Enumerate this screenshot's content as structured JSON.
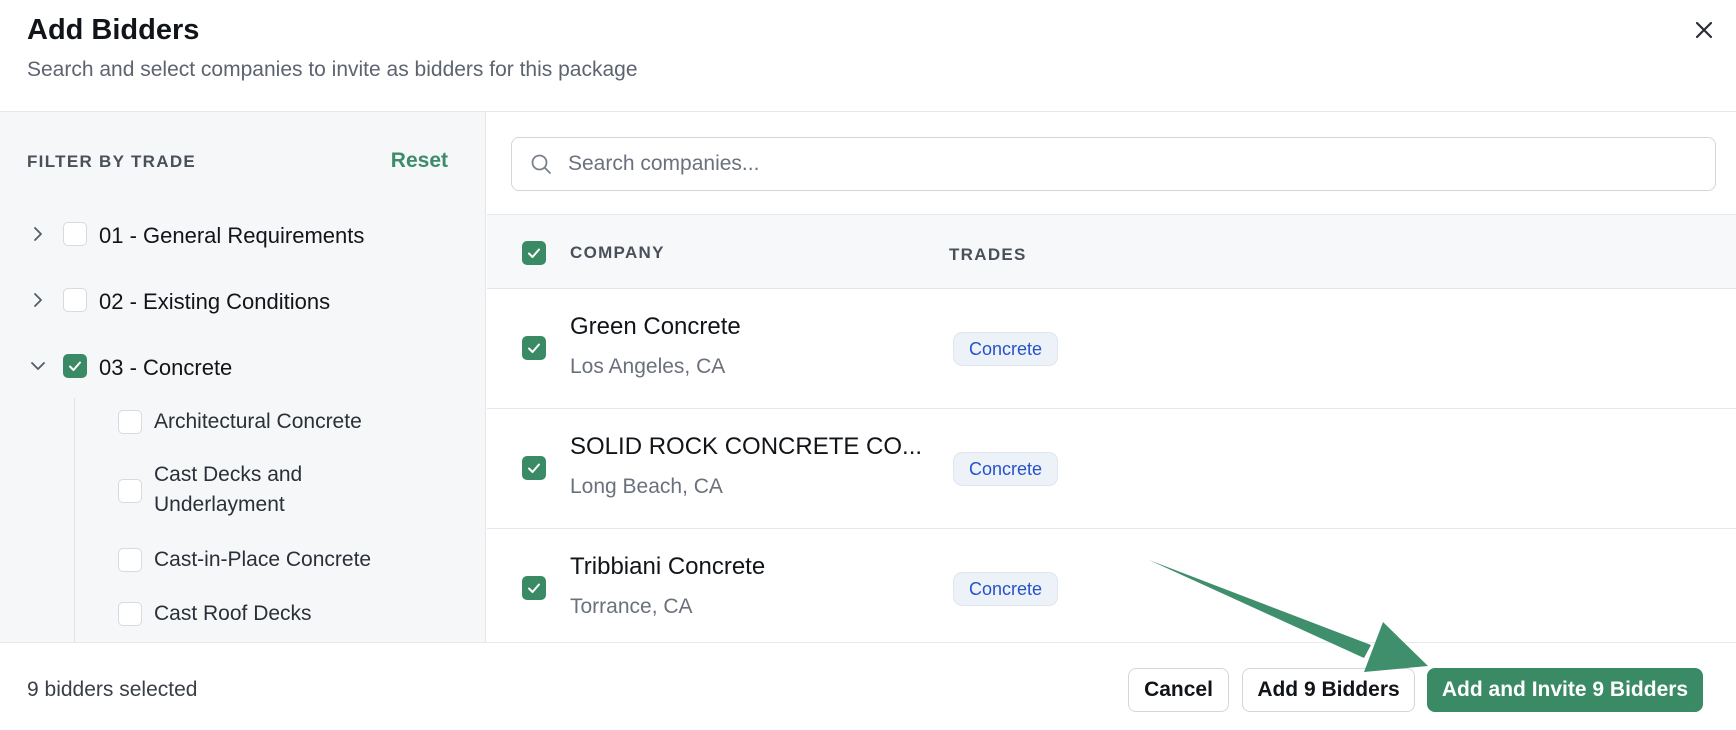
{
  "dialog": {
    "title": "Add Bidders",
    "subtitle": "Search and select companies to invite as bidders for this package"
  },
  "sidebar": {
    "filter_label": "FILTER BY TRADE",
    "reset_label": "Reset",
    "trades": [
      {
        "label": "01 - General Requirements",
        "checked": false,
        "expanded": false
      },
      {
        "label": "02 - Existing Conditions",
        "checked": false,
        "expanded": false
      },
      {
        "label": "03 - Concrete",
        "checked": true,
        "expanded": true
      }
    ],
    "subtrades": [
      {
        "label": "Architectural Concrete",
        "checked": false
      },
      {
        "label": "Cast Decks and Underlayment",
        "line1": "Cast Decks and",
        "line2": "Underlayment",
        "checked": false
      },
      {
        "label": "Cast-in-Place Concrete",
        "checked": false
      },
      {
        "label": "Cast Roof Decks",
        "checked": false
      }
    ]
  },
  "search": {
    "placeholder": "Search companies...",
    "value": ""
  },
  "table": {
    "columns": [
      "COMPANY",
      "TRADES"
    ],
    "select_all_checked": true,
    "rows": [
      {
        "name": "Green Concrete",
        "location": "Los Angeles, CA",
        "trade": "Concrete",
        "checked": true
      },
      {
        "name": "SOLID ROCK CONCRETE CO...",
        "location": "Long Beach, CA",
        "trade": "Concrete",
        "checked": true
      },
      {
        "name": "Tribbiani Concrete",
        "location": "Torrance, CA",
        "trade": "Concrete",
        "checked": true
      }
    ]
  },
  "footer": {
    "selected_count": "9 bidders selected",
    "cancel_label": "Cancel",
    "add_label": "Add 9 Bidders",
    "add_invite_label": "Add and Invite 9 Bidders"
  },
  "colors": {
    "accent": "#3a8a65",
    "badge_text": "#2552c9",
    "annotation_arrow": "#3f8f6c"
  },
  "icons": [
    "close-icon",
    "chevron-right-icon",
    "chevron-down-icon",
    "checkmark-icon",
    "search-icon",
    "annotation-arrow"
  ]
}
